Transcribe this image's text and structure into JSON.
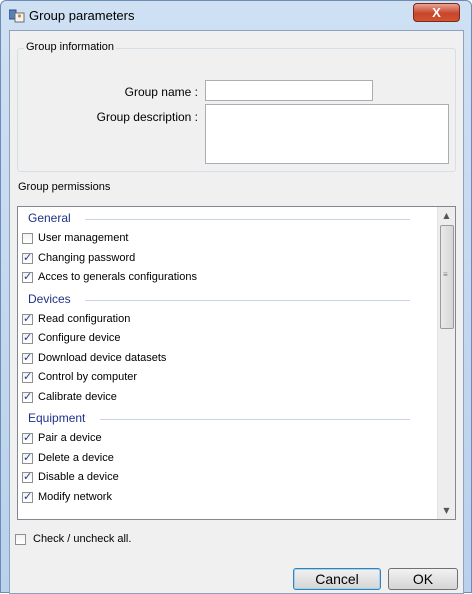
{
  "window": {
    "title": "Group parameters",
    "close_symbol": "X"
  },
  "group_info": {
    "legend": "Group information",
    "name_label": "Group name :",
    "name_value": "",
    "description_label": "Group description :",
    "description_value": ""
  },
  "permissions": {
    "legend": "Group permissions",
    "categories": [
      {
        "label": "General",
        "items": [
          {
            "label": "User management",
            "checked": false
          },
          {
            "label": "Changing password",
            "checked": true
          },
          {
            "label": "Acces to generals configurations",
            "checked": true
          }
        ]
      },
      {
        "label": "Devices",
        "items": [
          {
            "label": "Read configuration",
            "checked": true
          },
          {
            "label": "Configure device",
            "checked": true
          },
          {
            "label": "Download device datasets",
            "checked": true
          },
          {
            "label": "Control by computer",
            "checked": true
          },
          {
            "label": "Calibrate device",
            "checked": true
          }
        ]
      },
      {
        "label": "Equipment",
        "items": [
          {
            "label": "Pair a device",
            "checked": true
          },
          {
            "label": "Delete a device",
            "checked": true
          },
          {
            "label": "Disable a device",
            "checked": true
          },
          {
            "label": "Modify network",
            "checked": true
          }
        ]
      }
    ]
  },
  "check_all": {
    "label": "Check / uncheck all.",
    "checked": false
  },
  "buttons": {
    "cancel": "Cancel",
    "ok": "OK"
  },
  "colors": {
    "category_text": "#1e3287",
    "check_mark": "#1c3f95"
  }
}
